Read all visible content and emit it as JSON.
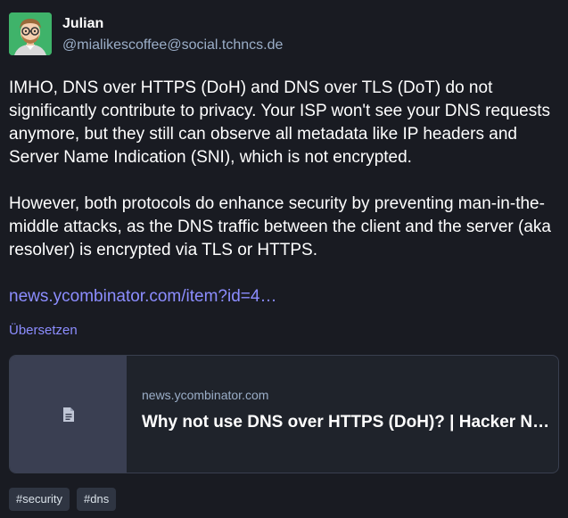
{
  "author": {
    "display_name": "Julian",
    "handle": "@mialikescoffee@social.tchncs.de"
  },
  "post": {
    "paragraph_1": "IMHO, DNS over HTTPS (DoH) and DNS over TLS (DoT) do not significantly contribute to privacy. Your ISP won't see your DNS requests anymore, but they still can observe all metadata like IP headers and Server Name Indication (SNI), which is not encrypted.",
    "paragraph_2": "However, both protocols do enhance security by preventing man-in-the-middle attacks, as the DNS traffic between the client and the server (aka resolver) is encrypted via TLS or HTTPS.",
    "link_text": "news.ycombinator.com/item?id=4…"
  },
  "translate_label": "Übersetzen",
  "card": {
    "host": "news.ycombinator.com",
    "title": "Why not use DNS over HTTPS (DoH)? | Hacker News",
    "icon": "file-text-icon"
  },
  "tags": [
    "#security",
    "#dns"
  ],
  "colors": {
    "background": "#191b22",
    "link": "#8c8dff",
    "muted": "#9baec8"
  }
}
